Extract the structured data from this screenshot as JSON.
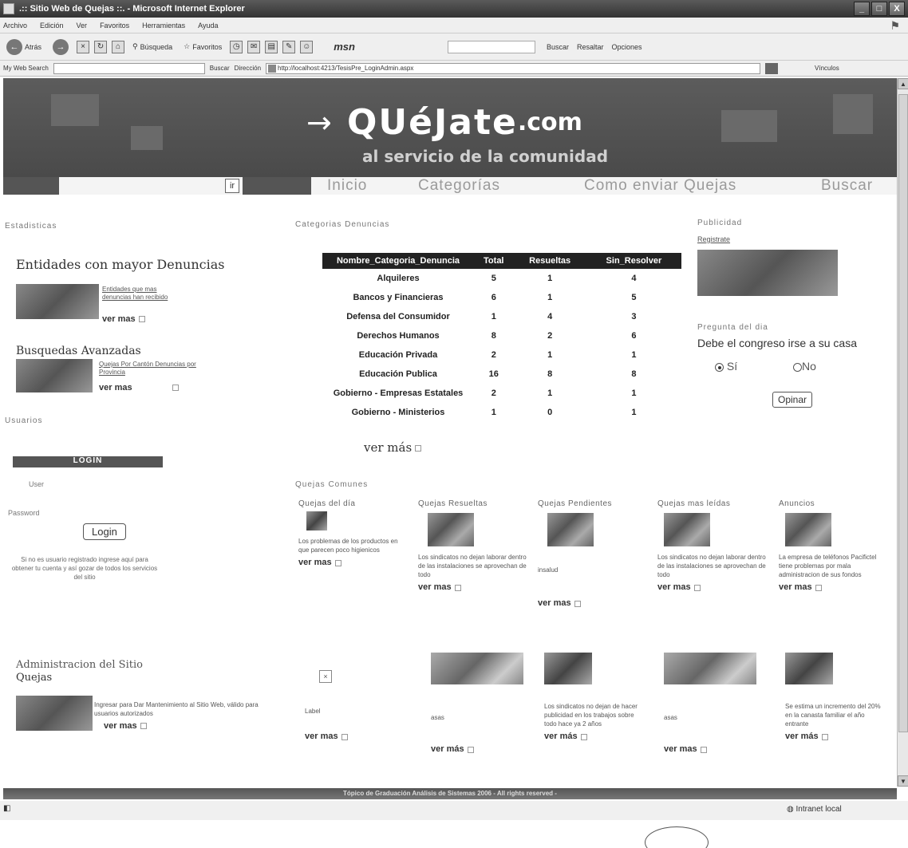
{
  "window": {
    "title": ".:: Sitio Web de Quejas ::. - Microsoft Internet Explorer",
    "controls": [
      "_",
      "□",
      "X"
    ]
  },
  "menu": [
    "Archivo",
    "Edición",
    "Ver",
    "Favoritos",
    "Herramientas",
    "Ayuda"
  ],
  "toolbar": {
    "back": "Atrás",
    "search": "Búsqueda",
    "favorites": "Favoritos",
    "msn": "msn",
    "buscar": "Buscar",
    "resaltar": "Resaltar",
    "opciones": "Opciones"
  },
  "addressbar": {
    "web_search_label": "My Web Search",
    "buscar": "Buscar",
    "direccion": "Dirección",
    "url": "http://localhost:4213/TesisPre_LoginAdmin.aspx",
    "vinculos": "Vínculos"
  },
  "banner": {
    "arrow": "→",
    "name": "QUéJate",
    "domain": ".com",
    "tagline": "al servicio de la comunidad"
  },
  "nav": {
    "ir": "ir",
    "items": [
      "Inicio",
      "Categorías",
      "Como enviar Quejas",
      "Buscar"
    ]
  },
  "left": {
    "estadisticas": "Estadisticas",
    "entidades_head": "Entidades con mayor Denuncias",
    "entidades_link": "Entidades que mas denuncias han recibido",
    "ver_mas": "ver mas",
    "busquedas_head": "Busquedas Avanzadas",
    "busquedas_link": "Quejas Por Cantón Denuncias por Provincia",
    "usuarios": "Usuarios",
    "login_title": "LOGIN",
    "user_label": "User",
    "password_label": "Password",
    "login_button": "Login",
    "register_text": "Si no es usuario registrado ingrese aquí para obtener tu cuenta y así gozar de todos los servicios del sitio",
    "admin_head": "Administracion del Sitio",
    "quejas_head": "Quejas",
    "admin_text": "Ingresar para Dar Mantenimiento al Sitio Web, válido para usuarios autorizados"
  },
  "categories": {
    "title": "Categorias Denuncias",
    "columns": [
      "Nombre_Categoria_Denuncia",
      "Total",
      "Resueltas",
      "Sin_Resolver"
    ],
    "rows": [
      [
        "Alquileres",
        "5",
        "1",
        "4"
      ],
      [
        "Bancos y Financieras",
        "6",
        "1",
        "5"
      ],
      [
        "Defensa del Consumidor",
        "1",
        "4",
        "3"
      ],
      [
        "Derechos Humanos",
        "8",
        "2",
        "6"
      ],
      [
        "Educación Privada",
        "2",
        "1",
        "1"
      ],
      [
        "Educación Publica",
        "16",
        "8",
        "8"
      ],
      [
        "Gobierno - Empresas Estatales",
        "2",
        "1",
        "1"
      ],
      [
        "Gobierno - Ministerios",
        "1",
        "0",
        "1"
      ]
    ],
    "ver_mas": "ver más"
  },
  "right": {
    "publicidad": "Publicidad",
    "registrate": "Registrate",
    "pregunta_label": "Pregunta del dia",
    "pregunta": "Debe el congreso irse a su casa",
    "opt_si": "Sí",
    "opt_no": "No",
    "opinar": "Opinar"
  },
  "quejas": {
    "title": "Quejas Comunes",
    "cards": [
      {
        "head": "Quejas del día",
        "text": "Los problemas de los productos en que parecen poco higienicos",
        "more": "ver mas"
      },
      {
        "head": "Quejas Resueltas",
        "text": "Los sindicatos no dejan laborar dentro de las instalaciones se aprovechan de todo",
        "more": "ver mas"
      },
      {
        "head": "Quejas Pendientes",
        "text": "insalud",
        "more": "ver mas"
      },
      {
        "head": "Quejas mas leídas",
        "text": "Los sindicatos no dejan laborar dentro de las instalaciones se aprovechan de todo",
        "more": "ver mas"
      },
      {
        "head": "Anuncios",
        "text": "La empresa de teléfonos Pacifictel tiene problemas por mala administracion de sus fondos",
        "more": "ver mas"
      }
    ],
    "row2": [
      {
        "text": "Label",
        "more": "ver mas"
      },
      {
        "text": "asas",
        "more": "ver más"
      },
      {
        "text": "Los sindicatos no dejan de hacer publicidad en los trabajos sobre todo hace ya 2 años",
        "more": "ver más"
      },
      {
        "text": "asas",
        "more": "ver mas"
      },
      {
        "text": "Se estima un incremento del 20% en la canasta familiar el año entrante",
        "more": "ver más"
      }
    ]
  },
  "footer": "Tópico de Graduación Análisis de Sistemas 2006 - All rights reserved -",
  "status": {
    "zone": "Intranet local"
  }
}
